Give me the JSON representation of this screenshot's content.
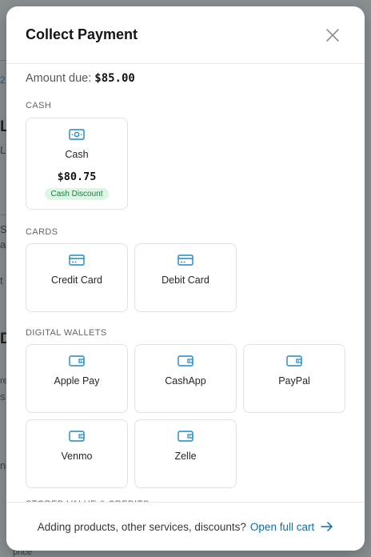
{
  "background": {
    "fragments": [
      "2",
      "L",
      "L",
      "S",
      "ac",
      "t",
      "De",
      "re",
      "s",
      "ne",
      "price"
    ]
  },
  "modal": {
    "title": "Collect Payment",
    "close_icon": "close-icon",
    "amount_due_label": "Amount due:",
    "amount_due_value": "$85.00",
    "sections": {
      "cash": {
        "label": "CASH",
        "tile": {
          "label": "Cash",
          "icon": "banknote-icon",
          "price": "$80.75",
          "badge": "Cash Discount"
        }
      },
      "cards": {
        "label": "CARDS",
        "tiles": [
          {
            "label": "Credit Card",
            "icon": "credit-card-icon"
          },
          {
            "label": "Debit Card",
            "icon": "credit-card-icon"
          }
        ]
      },
      "digital_wallets": {
        "label": "DIGITAL WALLETS",
        "tiles": [
          {
            "label": "Apple Pay",
            "icon": "wallet-icon"
          },
          {
            "label": "CashApp",
            "icon": "wallet-icon"
          },
          {
            "label": "PayPal",
            "icon": "wallet-icon"
          },
          {
            "label": "Venmo",
            "icon": "wallet-icon"
          },
          {
            "label": "Zelle",
            "icon": "wallet-icon"
          }
        ]
      },
      "stored_value": {
        "label": "STORED VALUE & CREDITS"
      }
    },
    "footer": {
      "prompt": "Adding products, other services, discounts?",
      "link": "Open full cart",
      "link_icon": "arrow-right-icon"
    }
  },
  "colors": {
    "accent": "#0f6fa6",
    "icon": "#1a8ac9",
    "badge_bg": "#dcf5e4",
    "badge_text": "#1f7a43"
  }
}
